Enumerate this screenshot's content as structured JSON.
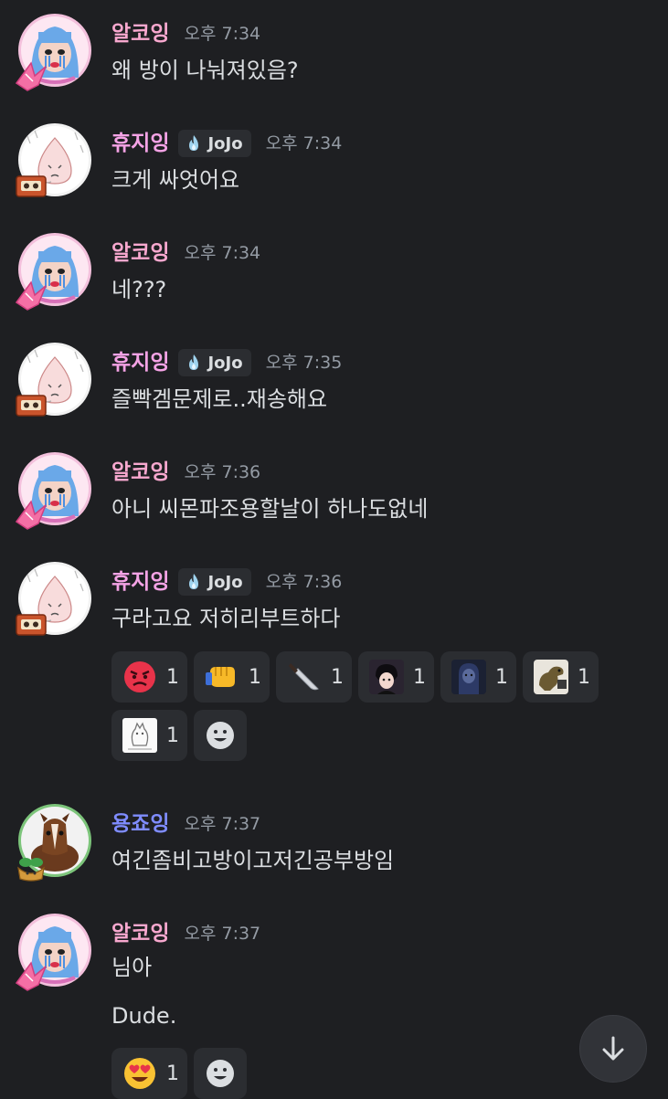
{
  "colors": {
    "background": "#1e1f22",
    "name_pink": "#f8a8cf",
    "name_hyu": "#f5a3e6",
    "name_yong": "#7f8cff",
    "time": "#949ba4",
    "reaction_bg": "#2b2d31"
  },
  "messages": [
    {
      "author": "알코잉",
      "time": "오후 7:34",
      "lines": [
        "왜 방이 나눠져있음?"
      ]
    },
    {
      "author": "휴지잉",
      "tag": "JoJo",
      "time": "오후 7:34",
      "lines": [
        "크게 싸엇어요"
      ]
    },
    {
      "author": "알코잉",
      "time": "오후 7:34",
      "lines": [
        "네???"
      ]
    },
    {
      "author": "휴지잉",
      "tag": "JoJo",
      "time": "오후 7:35",
      "lines": [
        "즐빡겜문제로..재송해요"
      ]
    },
    {
      "author": "알코잉",
      "time": "오후 7:36",
      "lines": [
        "아니 씨몬파조용할날이 하나도없네"
      ]
    },
    {
      "author": "휴지잉",
      "tag": "JoJo",
      "time": "오후 7:36",
      "lines": [
        "구라고요 저히리부트하다"
      ],
      "reactions": [
        {
          "icon": "angry-face-icon",
          "count": "1"
        },
        {
          "icon": "fist-icon",
          "count": "1"
        },
        {
          "icon": "knife-icon",
          "count": "1"
        },
        {
          "icon": "anime-character-icon",
          "count": "1"
        },
        {
          "icon": "dark-character-icon",
          "count": "1"
        },
        {
          "icon": "dinosaur-icon",
          "count": "1"
        },
        {
          "icon": "sketch-sticker-icon",
          "count": "1"
        }
      ]
    },
    {
      "author": "용죠잉",
      "time": "오후 7:37",
      "lines": [
        "여긴좀비고방이고저긴공부방임"
      ]
    },
    {
      "author": "알코잉",
      "time": "오후 7:37",
      "lines": [
        "님아",
        "Dude."
      ],
      "reactions": [
        {
          "icon": "heart-eyes-face-icon",
          "count": "1"
        }
      ]
    }
  ]
}
